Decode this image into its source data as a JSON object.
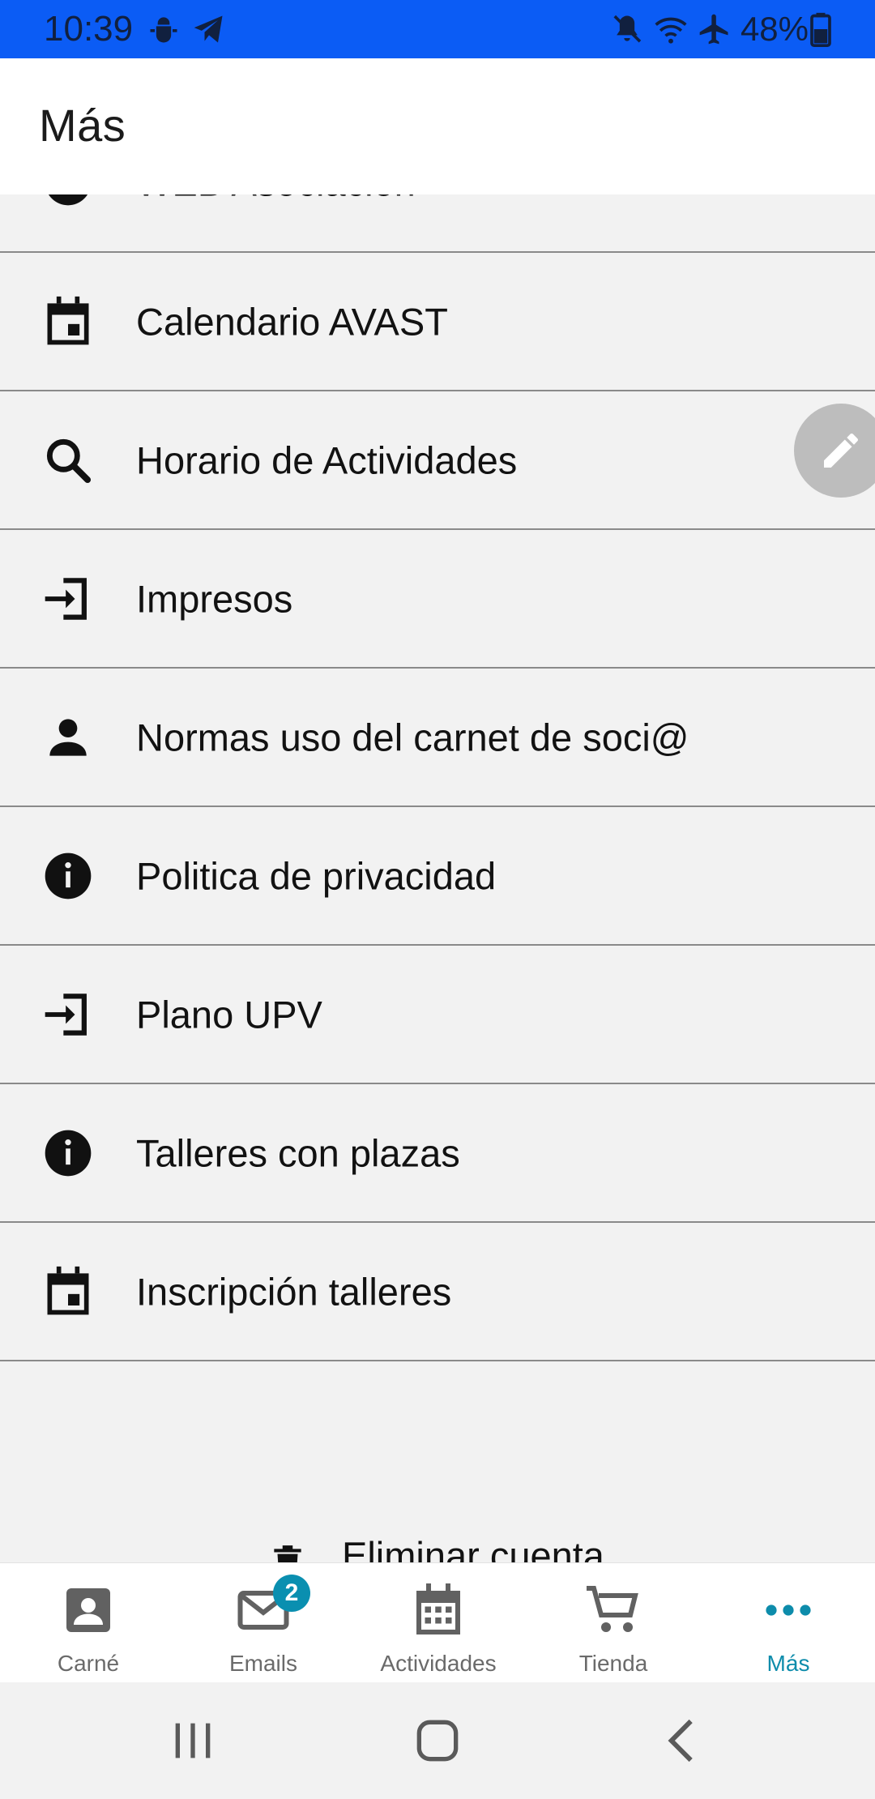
{
  "status_bar": {
    "time": "10:39",
    "battery": "48%",
    "icons": [
      "android-debug-icon",
      "telegram-icon",
      "mute-icon",
      "wifi-icon",
      "airplane-icon",
      "battery-icon"
    ]
  },
  "app_bar": {
    "title": "Más"
  },
  "list": {
    "partial_top": {
      "label": "WEB Asociación",
      "icon": "info-icon"
    },
    "items": [
      {
        "label": "Calendario AVAST",
        "icon": "calendar-icon"
      },
      {
        "label": "Horario de Actividades",
        "icon": "search-icon"
      },
      {
        "label": "Impresos",
        "icon": "login-icon"
      },
      {
        "label": "Normas uso del carnet de soci@",
        "icon": "person-icon"
      },
      {
        "label": "Politica de privacidad",
        "icon": "info-icon"
      },
      {
        "label": "Plano UPV",
        "icon": "login-icon"
      },
      {
        "label": "Talleres con plazas",
        "icon": "info-icon"
      },
      {
        "label": "Inscripción talleres",
        "icon": "calendar-icon"
      }
    ]
  },
  "delete_account": {
    "label": "Eliminar cuenta",
    "icon": "trash-icon"
  },
  "fab": {
    "icon": "edit-icon"
  },
  "bottom_nav": {
    "active_color": "#0d8cab",
    "items": [
      {
        "label": "Carné",
        "icon": "id-card-icon"
      },
      {
        "label": "Emails",
        "icon": "mail-icon",
        "badge": "2"
      },
      {
        "label": "Actividades",
        "icon": "calendar-grid-icon"
      },
      {
        "label": "Tienda",
        "icon": "cart-icon"
      },
      {
        "label": "Más",
        "icon": "more-icon",
        "active": true
      }
    ]
  },
  "colors": {
    "status_bar": "#0b5cf5",
    "background": "#f2f2f2",
    "divider": "#8a8a8a",
    "badge": "#0a8fb0"
  }
}
